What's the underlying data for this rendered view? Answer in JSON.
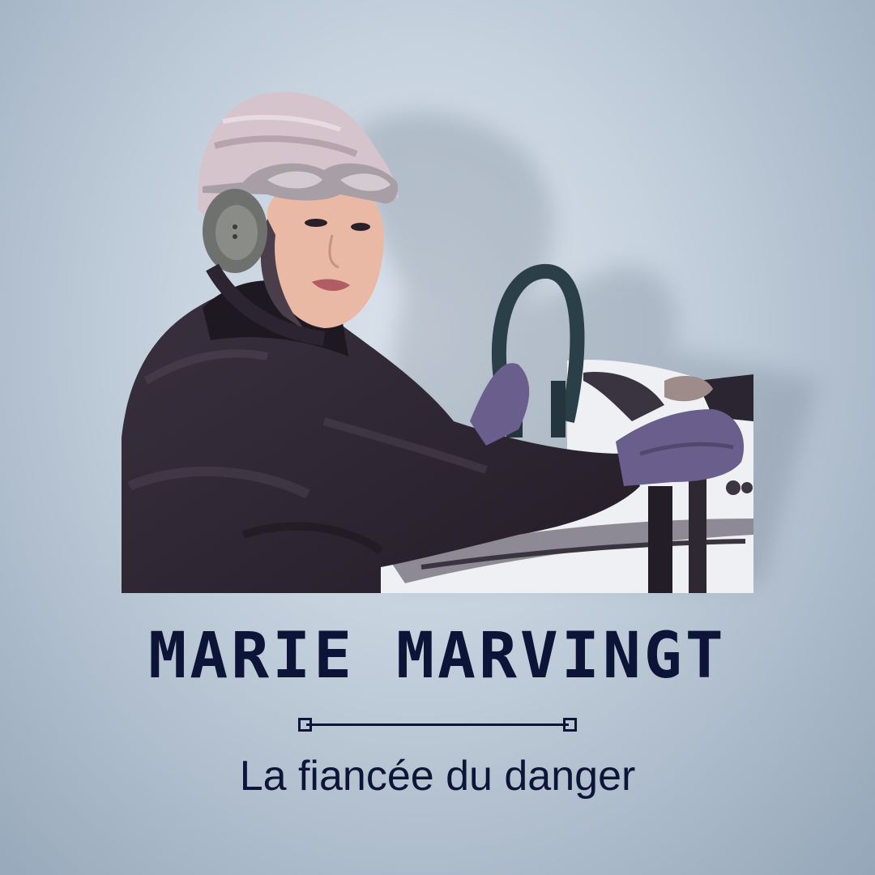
{
  "title": "MARIE MARVINGT",
  "subtitle": "La fiancée du danger",
  "colors": {
    "text": "#0c1538",
    "background": "#c6d2de",
    "coat": "#2e2530",
    "helmet": "#d6c4cc",
    "gloves": "#6a5f8c",
    "wheel": "#2b3f48"
  }
}
